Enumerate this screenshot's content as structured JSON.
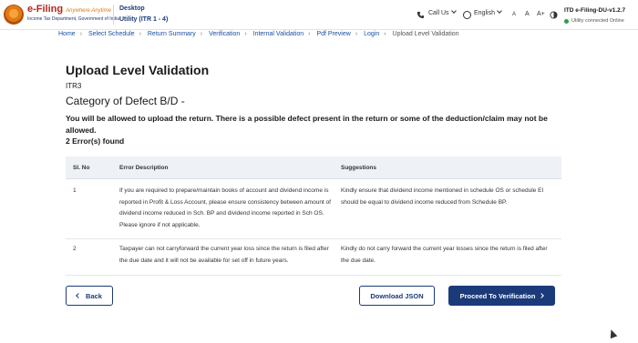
{
  "header": {
    "logo_title": "e-Filing",
    "logo_tagline": "Anywhere Anytime",
    "logo_subtitle": "Income Tax Department, Government of India",
    "app_line1": "Desktop",
    "app_line2": "Utility (ITR 1 - 4)",
    "call_us": "Call Us",
    "language": "English",
    "font_small": "A",
    "font_reset": "A",
    "font_large": "A+",
    "version": "ITD e-Filing-DU-v1.2.7",
    "status": "Utility connected Online"
  },
  "breadcrumb": [
    "Home",
    "Select Schedule",
    "Return Summary",
    "Verification",
    "Internal Validation",
    "Pdf Preview",
    "Login",
    "Upload Level Validation"
  ],
  "page": {
    "title": "Upload Level Validation",
    "form_name": "ITR3",
    "defect_category": "Category of Defect B/D -",
    "message": "You will be allowed to upload the return. There is a possible defect present in the return or some of the deduction/claim may not be allowed.",
    "error_count": "2 Error(s) found"
  },
  "table": {
    "headers": [
      "Sl. No",
      "Error Description",
      "Suggestions"
    ],
    "rows": [
      {
        "sl": "1",
        "description": "If you are required to prepare/maintain books of account and dividend income is reported in Profit & Loss Account, please ensure consistency between amount of dividend income reduced in Sch. BP and dividend income reported in Sch OS. Please ignore if not applicable.",
        "suggestion": "Kindly ensure that dividend income mentioned in schedule OS or schedule EI should be equal to dividend income reduced from Schedule BP."
      },
      {
        "sl": "2",
        "description": "Taxpayer can not carryforward the current year loss since the return is filed after the due date and it will not be available for set off in future years.",
        "suggestion": "Kindly do not carry forward the current year losses since the return is filed after the due date."
      }
    ]
  },
  "buttons": {
    "back": "Back",
    "download_json": "Download JSON",
    "proceed": "Proceed To Verification"
  },
  "colors": {
    "primary": "#1a3a7a",
    "link": "#1a4fa0",
    "online": "#2e9e4a",
    "brand_red": "#b3261e"
  },
  "icons": [
    "emblem-logo",
    "phone-icon",
    "globe-icon",
    "chevron-down-icon",
    "contrast-icon",
    "chevron-left-icon",
    "chevron-right-icon",
    "mouse-cursor-icon"
  ]
}
